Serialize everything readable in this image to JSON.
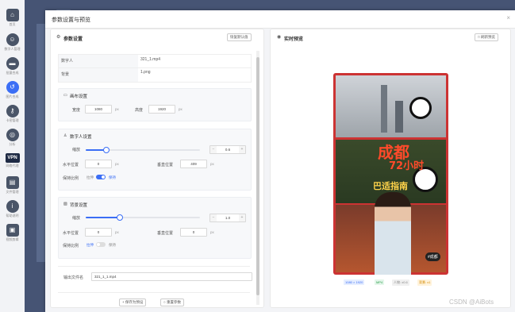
{
  "sidebar": {
    "items": [
      {
        "label": "首页",
        "icon": "home-icon",
        "glyph": "⌂"
      },
      {
        "label": "数字人管理",
        "icon": "robot-icon",
        "glyph": "☺"
      },
      {
        "label": "批量合成",
        "icon": "chat-icon",
        "glyph": "▬"
      },
      {
        "label": "图片合成",
        "icon": "undo-icon",
        "glyph": "↺"
      },
      {
        "label": "卡密管理",
        "icon": "key-icon",
        "glyph": "⚷"
      },
      {
        "label": "分析",
        "icon": "chart-icon",
        "glyph": "◎"
      },
      {
        "label": "网络代理",
        "icon": "vpn-icon",
        "glyph": "VPN"
      },
      {
        "label": "文件管理",
        "icon": "file-icon",
        "glyph": "▤"
      },
      {
        "label": "帮助说明",
        "icon": "info-icon",
        "glyph": "i"
      },
      {
        "label": "视频剪辑",
        "icon": "video-icon",
        "glyph": "▣"
      }
    ]
  },
  "dialog": {
    "title": "参数设置与预览",
    "close": "×"
  },
  "left": {
    "title": "参数设置",
    "reset_btn": "恢复默认值",
    "digital_human_label": "数字人",
    "digital_human_value": "321_1.mp4",
    "background_label": "背景",
    "background_value": "1.png",
    "canvas": {
      "title": "画布设置",
      "width_label": "宽度",
      "width": "1080",
      "height_label": "高度",
      "height": "1920",
      "unit": "px"
    },
    "dh": {
      "title": "数字人设置",
      "scale_label": "缩放",
      "scale": "0.6",
      "scale_fill": 0.18,
      "x_label": "水平位置",
      "x": "0",
      "y_label": "垂直位置",
      "y": "409",
      "ratio_label": "保持比例",
      "ratio_off": "拉伸",
      "ratio_on": "保持",
      "unit": "px"
    },
    "bg": {
      "title": "背景设置",
      "scale_label": "缩放",
      "scale": "1.0",
      "scale_fill": 0.3,
      "x_label": "水平位置",
      "x": "0",
      "y_label": "垂直位置",
      "y": "0",
      "ratio_label": "保持比例",
      "ratio_off": "拉伸",
      "ratio_on": "保持",
      "unit": "px"
    },
    "output_label": "输出文件名",
    "output_value": "321_1_1.mp4",
    "save_btn": "+ 保存为预设",
    "reset_params_btn": "○ 重置参数"
  },
  "right": {
    "title": "实时预览",
    "refresh_btn": "□ 刷新预览",
    "badges": [
      {
        "text": "1080 × 1920",
        "color": "#3b6ef5",
        "bg": "#e6eeff"
      },
      {
        "text": "MP4",
        "color": "#2a9d4a",
        "bg": "#e4f6ea"
      },
      {
        "text": "人物: x0.6",
        "color": "#888",
        "bg": "#f0f0f0"
      },
      {
        "text": "背景: x1",
        "color": "#d48a00",
        "bg": "#fff3dc"
      }
    ],
    "poster": {
      "line1": "成都",
      "line2": "72小时",
      "line3": "巴适指南",
      "tag": "#成都"
    }
  },
  "watermark": "CSDN @AiBots"
}
